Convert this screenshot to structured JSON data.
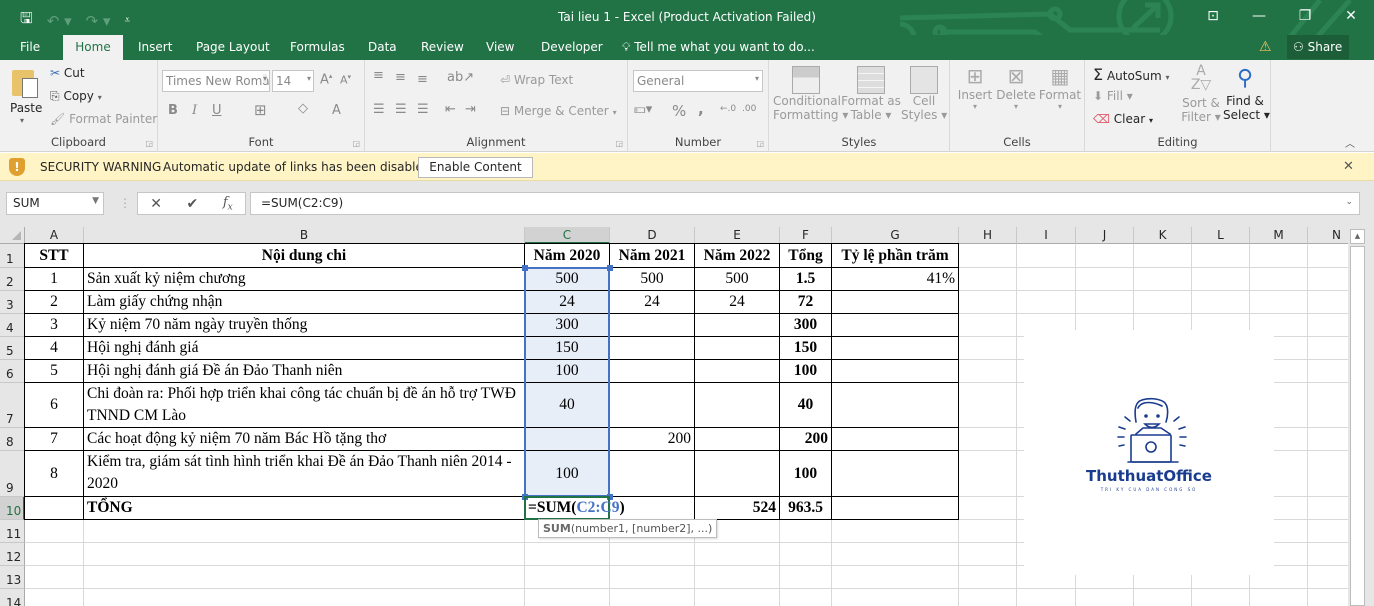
{
  "titlebar": {
    "title": "Tai lieu 1 - Excel (Product Activation Failed)",
    "qat": [
      "save-icon",
      "undo-icon",
      "redo-icon",
      "customize-icon"
    ],
    "window_buttons": [
      "ribbon-display-icon",
      "minimize-icon",
      "restore-icon",
      "close-icon"
    ]
  },
  "tabs": {
    "items": [
      "File",
      "Home",
      "Insert",
      "Page Layout",
      "Formulas",
      "Data",
      "Review",
      "View",
      "Developer"
    ],
    "active": "Home",
    "tell_me": "Tell me what you want to do...",
    "share": "Share"
  },
  "ribbon": {
    "clipboard": {
      "label": "Clipboard",
      "paste": "Paste",
      "cut": "Cut",
      "copy": "Copy",
      "format_painter": "Format Painter"
    },
    "font": {
      "label": "Font",
      "font_name": "Times New Roma",
      "font_size": "14",
      "bold": "B",
      "italic": "I",
      "underline": "U",
      "font_color": "A"
    },
    "alignment": {
      "label": "Alignment",
      "wrap_text": "Wrap Text",
      "merge_center": "Merge & Center"
    },
    "number": {
      "label": "Number",
      "format": "General",
      "percent": "%",
      "comma": ","
    },
    "styles": {
      "label": "Styles",
      "conditional": [
        "Conditional",
        "Formatting"
      ],
      "format_table": [
        "Format as",
        "Table"
      ],
      "cell_styles": [
        "Cell",
        "Styles"
      ]
    },
    "cells": {
      "label": "Cells",
      "insert": "Insert",
      "delete": "Delete",
      "format": "Format"
    },
    "editing": {
      "label": "Editing",
      "autosum": "AutoSum",
      "fill": "Fill",
      "clear": "Clear",
      "sort_filter": [
        "Sort &",
        "Filter"
      ],
      "find_select": [
        "Find &",
        "Select"
      ]
    }
  },
  "security": {
    "label": "SECURITY WARNING",
    "message": "Automatic update of links has been disabled",
    "button": "Enable Content"
  },
  "formula_bar": {
    "name_box": "SUM",
    "formula": "=SUM(C2:C9)",
    "fx": "fx"
  },
  "grid": {
    "columns": [
      "A",
      "B",
      "C",
      "D",
      "E",
      "F",
      "G",
      "H",
      "I",
      "J",
      "K",
      "L",
      "M",
      "N"
    ],
    "rows": [
      "1",
      "2",
      "3",
      "4",
      "5",
      "6",
      "7",
      "8",
      "9",
      "10",
      "11",
      "12",
      "13",
      "14"
    ],
    "selected_column": "C",
    "selected_row": "10",
    "header": [
      "STT",
      "Nội dung chi",
      "Năm 2020",
      "Năm 2021",
      "Năm 2022",
      "Tổng",
      "Tỷ lệ phần trăm"
    ],
    "data": [
      {
        "stt": "1",
        "content": "Sản xuất kỷ niệm chương",
        "y2020": "500",
        "y2021": "500",
        "y2022": "500",
        "total": "1.5",
        "pct": "41%"
      },
      {
        "stt": "2",
        "content": "Làm giấy chứng nhận",
        "y2020": "24",
        "y2021": "24",
        "y2022": "24",
        "total": "72",
        "pct": ""
      },
      {
        "stt": "3",
        "content": "Kỷ niệm 70 năm ngày truyền thống",
        "y2020": "300",
        "y2021": "",
        "y2022": "",
        "total": "300",
        "pct": ""
      },
      {
        "stt": "4",
        "content": "Hội nghị đánh giá",
        "y2020": "150",
        "y2021": "",
        "y2022": "",
        "total": "150",
        "pct": ""
      },
      {
        "stt": "5",
        "content": "Hội nghị đánh giá Đề án Đảo Thanh niên",
        "y2020": "100",
        "y2021": "",
        "y2022": "",
        "total": "100",
        "pct": ""
      },
      {
        "stt": "6",
        "content": "Chi đoàn ra: Phối hợp triển khai công tác chuẩn bị đề án hỗ trợ TWĐ TNND CM Lào",
        "y2020": "40",
        "y2021": "",
        "y2022": "",
        "total": "40",
        "pct": ""
      },
      {
        "stt": "7",
        "content": "Các hoạt động kỷ niệm 70 năm Bác Hồ tặng thơ",
        "y2020": "",
        "y2021": "200",
        "y2022": "",
        "total": "200",
        "pct": ""
      },
      {
        "stt": "8",
        "content": "Kiểm tra, giám sát tình hình triển khai Đề án Đảo Thanh niên 2014 - 2020",
        "y2020": "100",
        "y2021": "",
        "y2022": "",
        "total": "100",
        "pct": ""
      }
    ],
    "total_row": {
      "label": "TỔNG",
      "editing_prefix": "=SUM(",
      "editing_ref": "C2:C9",
      "editing_suffix": ")",
      "y2022": "524",
      "total": "963.5"
    },
    "tooltip": {
      "fn": "SUM",
      "args": "(number1, [number2], ...)"
    }
  },
  "logo": {
    "brand": "ThuthuatOffice",
    "tagline": "TRI KY CUA DAN CONG SO"
  },
  "colors": {
    "excel_green": "#217346",
    "range_blue": "#4472c4",
    "warning_bg": "#fff4c6",
    "logo_blue": "#1a3c8f"
  }
}
